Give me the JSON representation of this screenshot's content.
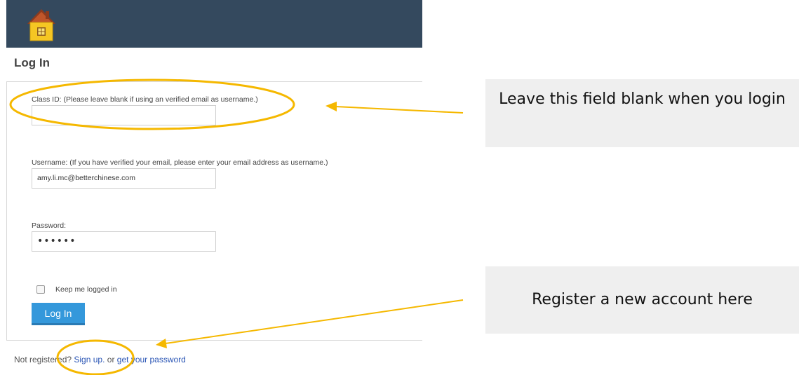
{
  "app": {
    "logo_icon": "home-icon",
    "header_color": "#34495e"
  },
  "login": {
    "title": "Log In",
    "class_id_label": "Class ID: (Please leave blank if using an verified email as username.)",
    "class_id_value": "",
    "username_label": "Username: (If you have verified your email, please enter your email address as username.)",
    "username_value": "amy.li.mc@betterchinese.com",
    "password_label": "Password:",
    "password_value": "••••••",
    "keep_logged_in_label": "Keep me logged in",
    "keep_logged_in_checked": false,
    "submit_label": "Log In",
    "button_color": "#3498db"
  },
  "footer": {
    "prefix": "Not registered?",
    "signup_link": "Sign up.",
    "middle": "or",
    "get_password_link": "get your password"
  },
  "annotations": {
    "callout_class_id": "Leave this field blank when you login",
    "callout_register": "Register a new account here",
    "highlight_color": "#f5b800"
  }
}
